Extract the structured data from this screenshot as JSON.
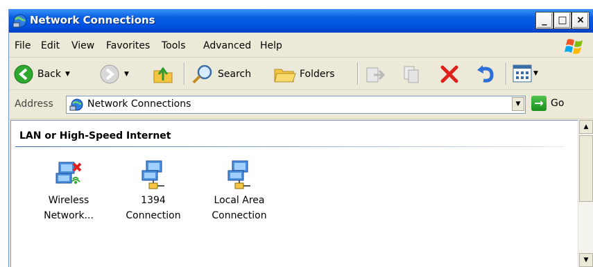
{
  "window": {
    "title": "Network Connections"
  },
  "title_buttons": {
    "minimize": "_",
    "maximize": "□",
    "close": "×"
  },
  "menu": [
    "File",
    "Edit",
    "View",
    "Favorites",
    "Tools",
    "Advanced",
    "Help"
  ],
  "toolbar": {
    "back": "Back",
    "search": "Search",
    "folders": "Folders"
  },
  "address": {
    "label": "Address",
    "value": "Network Connections",
    "go": "Go"
  },
  "content": {
    "group_header": "LAN or High-Speed Internet",
    "items": [
      {
        "line1": "Wireless",
        "line2": "Network...",
        "icon": "wireless-network-disconnected-icon"
      },
      {
        "line1": "1394",
        "line2": "Connection",
        "icon": "network-connection-icon"
      },
      {
        "line1": "Local Area",
        "line2": "Connection",
        "icon": "network-connection-icon"
      }
    ]
  },
  "colors": {
    "titlebar": "#0054e3",
    "chrome": "#ece9d8",
    "border": "#7f9db9"
  }
}
